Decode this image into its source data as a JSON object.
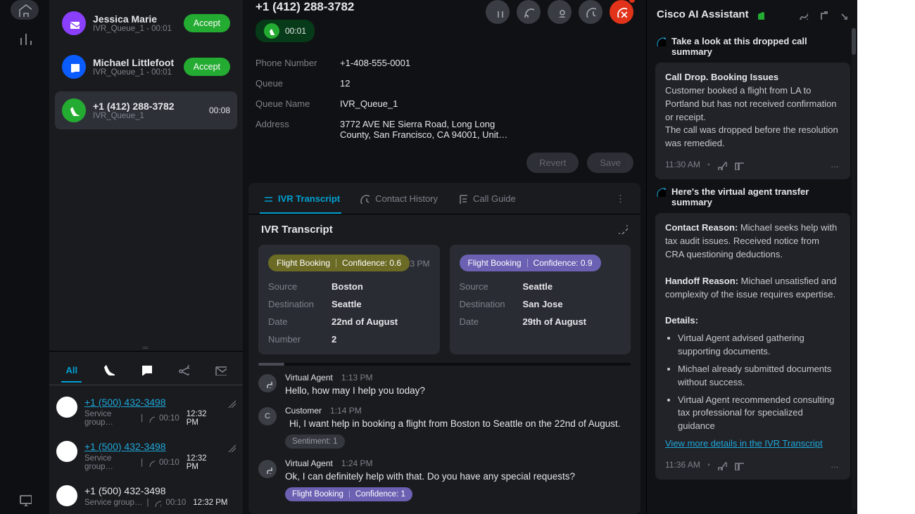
{
  "rail": {
    "home": "home",
    "analytics": "analytics"
  },
  "contacts": [
    {
      "name": "Jessica Marie",
      "sub": "IVR_Queue_1 - 00:01",
      "accept": "Accept",
      "avatar_bg": "#8a3ffc",
      "icon": "mail"
    },
    {
      "name": "Michael Littlefoot",
      "sub": "IVR_Queue_1 - 00:01",
      "accept": "Accept",
      "avatar_bg": "#0b5cff",
      "icon": "chat"
    },
    {
      "name": "+1 (412) 288-3782",
      "sub": "IVR_Queue_1",
      "time": "00:08",
      "avatar_bg": "#24ab31",
      "icon": "phone",
      "active": true
    }
  ],
  "historyTabs": {
    "all": "All"
  },
  "history": [
    {
      "num": "+1 (500) 432-3498",
      "link": true,
      "group": "Service group…",
      "dur": "00:10",
      "ts": "12:32 PM",
      "icon": "phone",
      "edit": true
    },
    {
      "num": "+1 (500) 432-3498",
      "link": true,
      "group": "Service group…",
      "dur": "00:10",
      "ts": "12:32 PM",
      "icon": "phone",
      "edit": true
    },
    {
      "num": "+1 (500) 432-3498",
      "link": false,
      "group": "Service group…",
      "dur": "00:10",
      "ts": "12:32 PM",
      "icon": "chat",
      "edit": false
    }
  ],
  "header": {
    "title": "+1 (412) 288-3782",
    "callTimer": "00:01",
    "fields": {
      "phone_l": "Phone Number",
      "phone_v": "+1-408-555-0001",
      "queue_l": "Queue",
      "queue_v": "12",
      "qname_l": "Queue Name",
      "qname_v": "IVR_Queue_1",
      "addr_l": "Address",
      "addr_v": "3772 AVE NE Sierra Road, Long Long County, San Francisco, CA 94001, Unit…"
    },
    "revert": "Revert",
    "save": "Save"
  },
  "tabs": {
    "ivr": "IVR Transcript",
    "hist": "Contact History",
    "guide": "Call Guide"
  },
  "ivr": {
    "title": "IVR Transcript",
    "cards": [
      {
        "badge_label": "Flight Booking",
        "badge_conf": "Confidence: 0.6",
        "badge_cls": "olive",
        "time": "1:13 PM",
        "rows": {
          "src_l": "Source",
          "src_v": "Boston",
          "dst_l": "Destination",
          "dst_v": "Seattle",
          "date_l": "Date",
          "date_v": "22nd of August",
          "num_l": "Number",
          "num_v": "2"
        }
      },
      {
        "badge_label": "Flight Booking",
        "badge_conf": "Confidence: 0.9",
        "badge_cls": "purple",
        "rows": {
          "src_l": "Source",
          "src_v": "Seattle",
          "dst_l": "Destination",
          "dst_v": "San Jose",
          "date_l": "Date",
          "date_v": "29th of August"
        }
      }
    ],
    "msgs": [
      {
        "who": "Virtual Agent",
        "time": "1:13 PM",
        "text": "Hello, how may I help you today?",
        "avatar": "bot"
      },
      {
        "who": "Customer",
        "time": "1:14 PM",
        "text": "Hi, I want help in booking a flight from Boston to Seattle on the 22nd of August.",
        "avatar": "C",
        "sentiment": "Sentiment: 1"
      },
      {
        "who": "Virtual Agent",
        "time": "1:24 PM",
        "text": "Ok, I can definitely help with that. Do you have any special requests?",
        "avatar": "bot",
        "chip_label": "Flight Booking",
        "chip_conf": "Confidence: 1"
      }
    ]
  },
  "assistant": {
    "title": "Cisco AI Assistant",
    "sections": [
      {
        "heading": "Take a look at this dropped call summary",
        "body_title": "Call Drop. Booking Issues",
        "body": "Customer booked a flight from LA to Portland but has not received confirmation or receipt.\nThe call was dropped before the resolution was remedied.",
        "time": "11:30 AM"
      },
      {
        "heading": "Here's the virtual agent transfer summary",
        "contact_l": "Contact Reason:",
        "contact_v": " Michael seeks help with tax audit issues. Received notice from CRA questioning deductions.",
        "handoff_l": "Handoff Reason:",
        "handoff_v": " Michael unsatisfied and complexity of the issue requires expertise.",
        "details_l": "Details:",
        "details": [
          "Virtual Agent advised gathering supporting documents.",
          "Michael already submitted documents without success.",
          "Virtual Agent recommended consulting tax professional for specialized guidance"
        ],
        "link": "View more details in the IVR Transcript",
        "time": "11:36 AM"
      }
    ]
  }
}
